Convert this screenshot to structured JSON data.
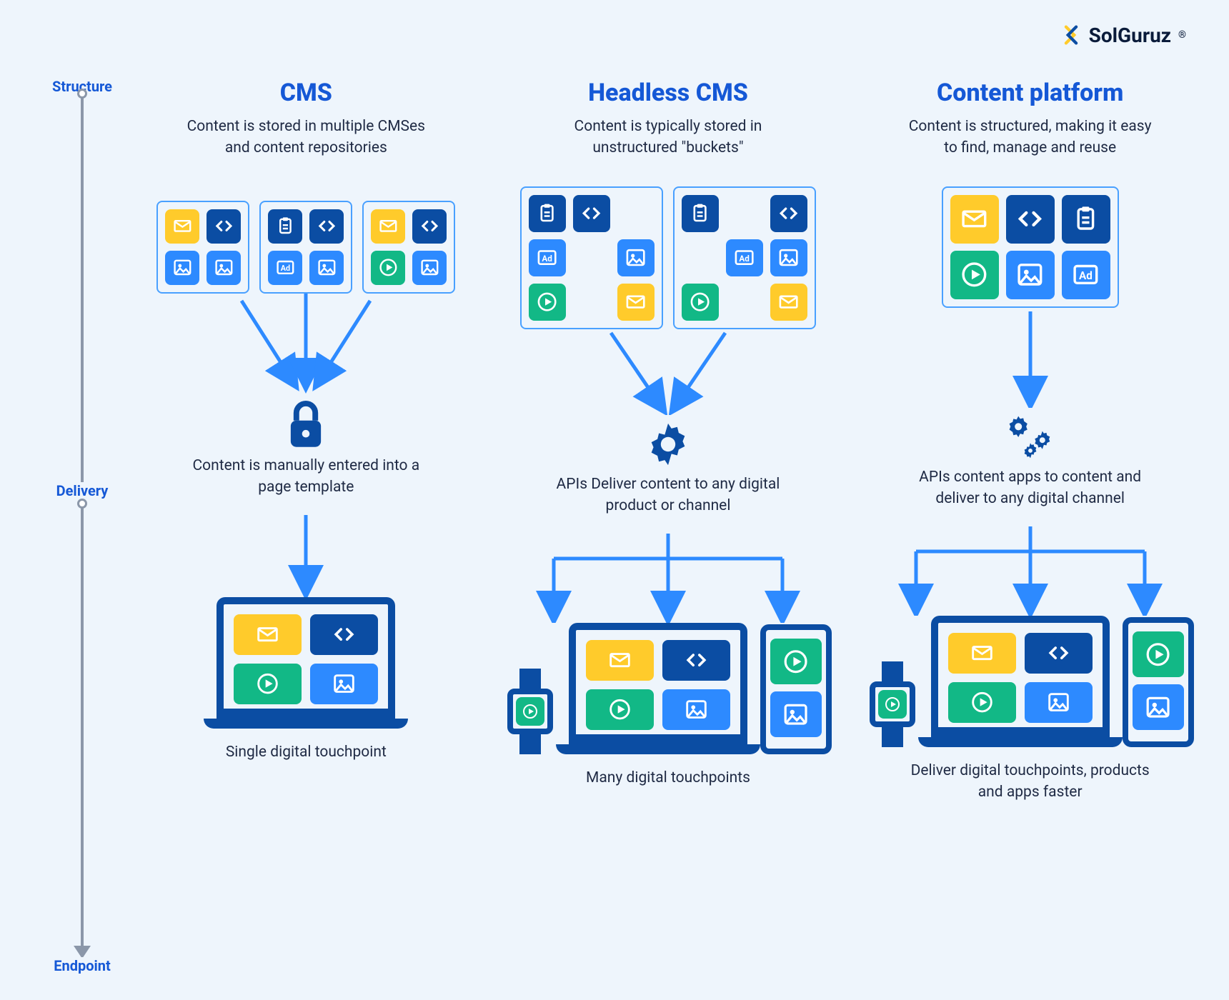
{
  "brand": {
    "name": "SolGuruz",
    "registered": "®"
  },
  "timeline": {
    "structure": "Structure",
    "delivery": "Delivery",
    "endpoint": "Endpoint"
  },
  "columns": [
    {
      "title": "CMS",
      "structure_desc": "Content is stored in multiple CMSes and content repositories",
      "delivery_desc": "Content is manually entered into a page template",
      "endpoint_desc": "Single digital touchpoint"
    },
    {
      "title": "Headless CMS",
      "structure_desc": "Content is typically stored in unstructured \"buckets\"",
      "delivery_desc": "APIs Deliver content to any digital product or channel",
      "endpoint_desc": "Many digital touchpoints"
    },
    {
      "title": "Content platform",
      "structure_desc": "Content is structured, making it easy to find, manage and reuse",
      "delivery_desc": "APIs content apps to content and deliver to any digital channel",
      "endpoint_desc": "Deliver digital touchpoints, products and apps faster"
    }
  ],
  "icons": {
    "mail": "mail-icon",
    "code": "code-icon",
    "image": "image-icon",
    "ad": "ad-icon",
    "clipboard": "clipboard-icon",
    "play": "play-icon",
    "lock": "lock-icon",
    "gear": "gear-icon",
    "gears": "gears-icon"
  }
}
